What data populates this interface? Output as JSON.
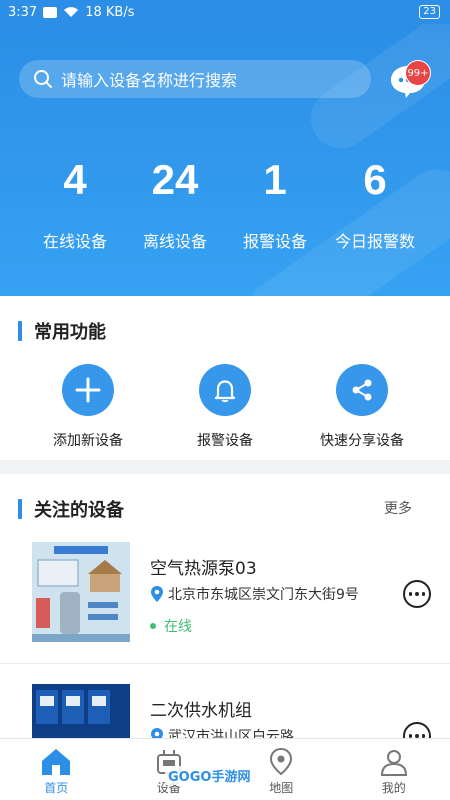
{
  "status_bar": {
    "time": "3:37",
    "speed": "18 KB/s",
    "battery": "23"
  },
  "search": {
    "placeholder": "请输入设备名称进行搜索"
  },
  "messages": {
    "badge": "99+"
  },
  "stats": [
    {
      "value": "4",
      "label": "在线设备"
    },
    {
      "value": "24",
      "label": "离线设备"
    },
    {
      "value": "1",
      "label": "报警设备"
    },
    {
      "value": "6",
      "label": "今日报警数"
    }
  ],
  "common_functions": {
    "title": "常用功能",
    "items": [
      {
        "label": "添加新设备",
        "icon": "plus-icon"
      },
      {
        "label": "报警设备",
        "icon": "bell-icon"
      },
      {
        "label": "快速分享设备",
        "icon": "share-icon"
      }
    ]
  },
  "followed_devices": {
    "title": "关注的设备",
    "more": "更多",
    "items": [
      {
        "name": "空气热源泵03",
        "address": "北京市东城区崇文门东大街9号",
        "status": "在线"
      },
      {
        "name": "二次供水机组",
        "address": "武汉市洪山区白云路",
        "status": ""
      }
    ]
  },
  "tabbar": [
    {
      "label": "首页",
      "icon": "home-icon",
      "active": true
    },
    {
      "label": "设备",
      "icon": "device-icon",
      "active": false
    },
    {
      "label": "地图",
      "icon": "map-pin-icon",
      "active": false
    },
    {
      "label": "我的",
      "icon": "user-icon",
      "active": false
    }
  ],
  "watermark": "GOGO手游网",
  "colors": {
    "primary": "#2c8ee6",
    "online": "#3cbf74",
    "badge": "#e84545"
  }
}
